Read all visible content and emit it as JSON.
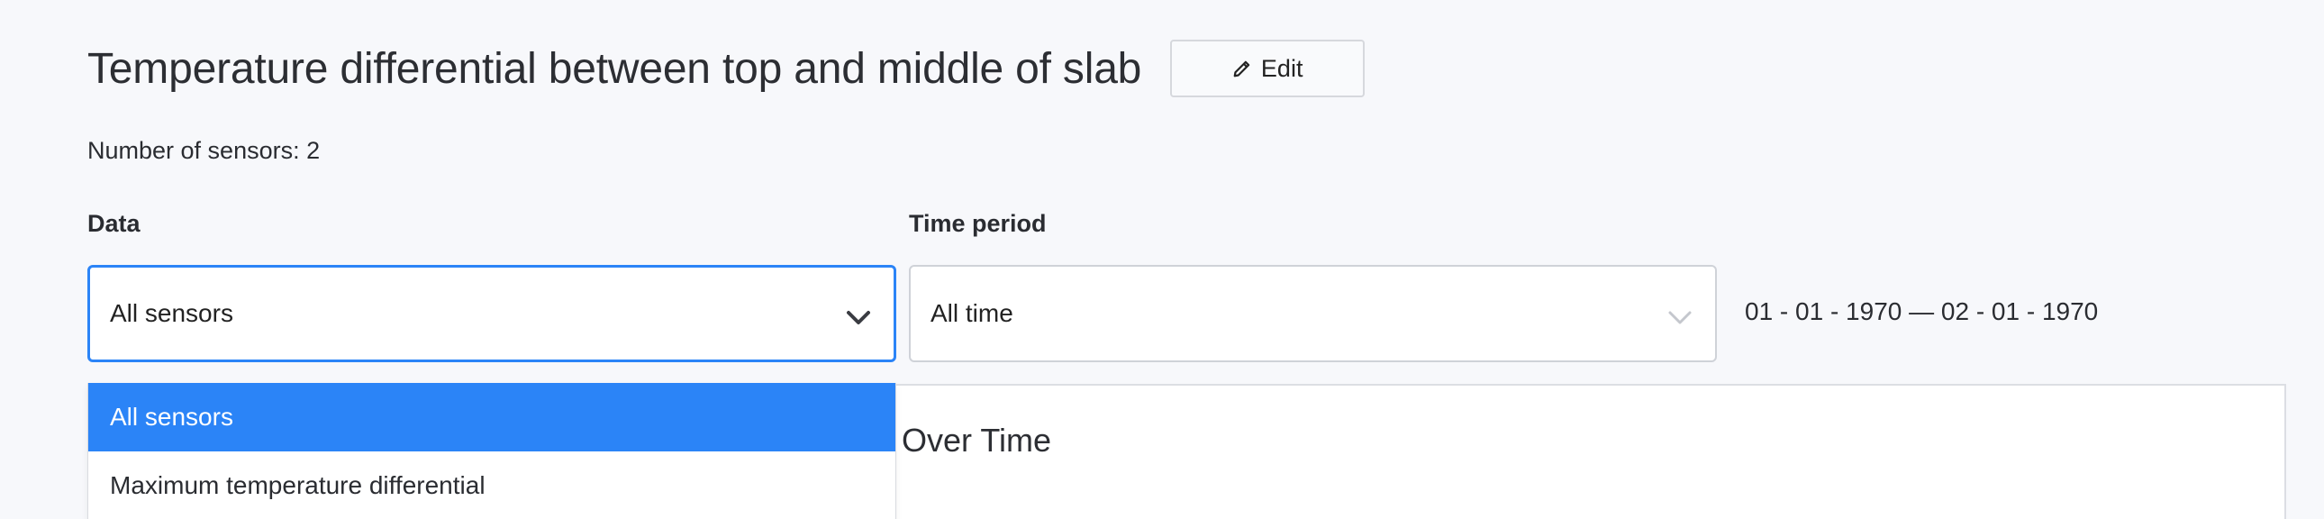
{
  "header": {
    "title": "Temperature differential between top and middle of slab",
    "edit_label": "Edit"
  },
  "sensor_count_text": "Number of sensors: 2",
  "data_field": {
    "label": "Data",
    "selected": "All sensors",
    "options": [
      "All sensors",
      "Maximum temperature differential"
    ]
  },
  "time_field": {
    "label": "Time period",
    "selected": "All time"
  },
  "date_range": "01 - 01 - 1970 — 02 - 01 - 1970",
  "chart": {
    "title_visible": "Over Time"
  },
  "colors": {
    "accent": "#2b84f7",
    "background": "#f7f8fb"
  },
  "icons": {
    "edit": "pencil-icon",
    "dropdown": "chevron-down-icon"
  }
}
